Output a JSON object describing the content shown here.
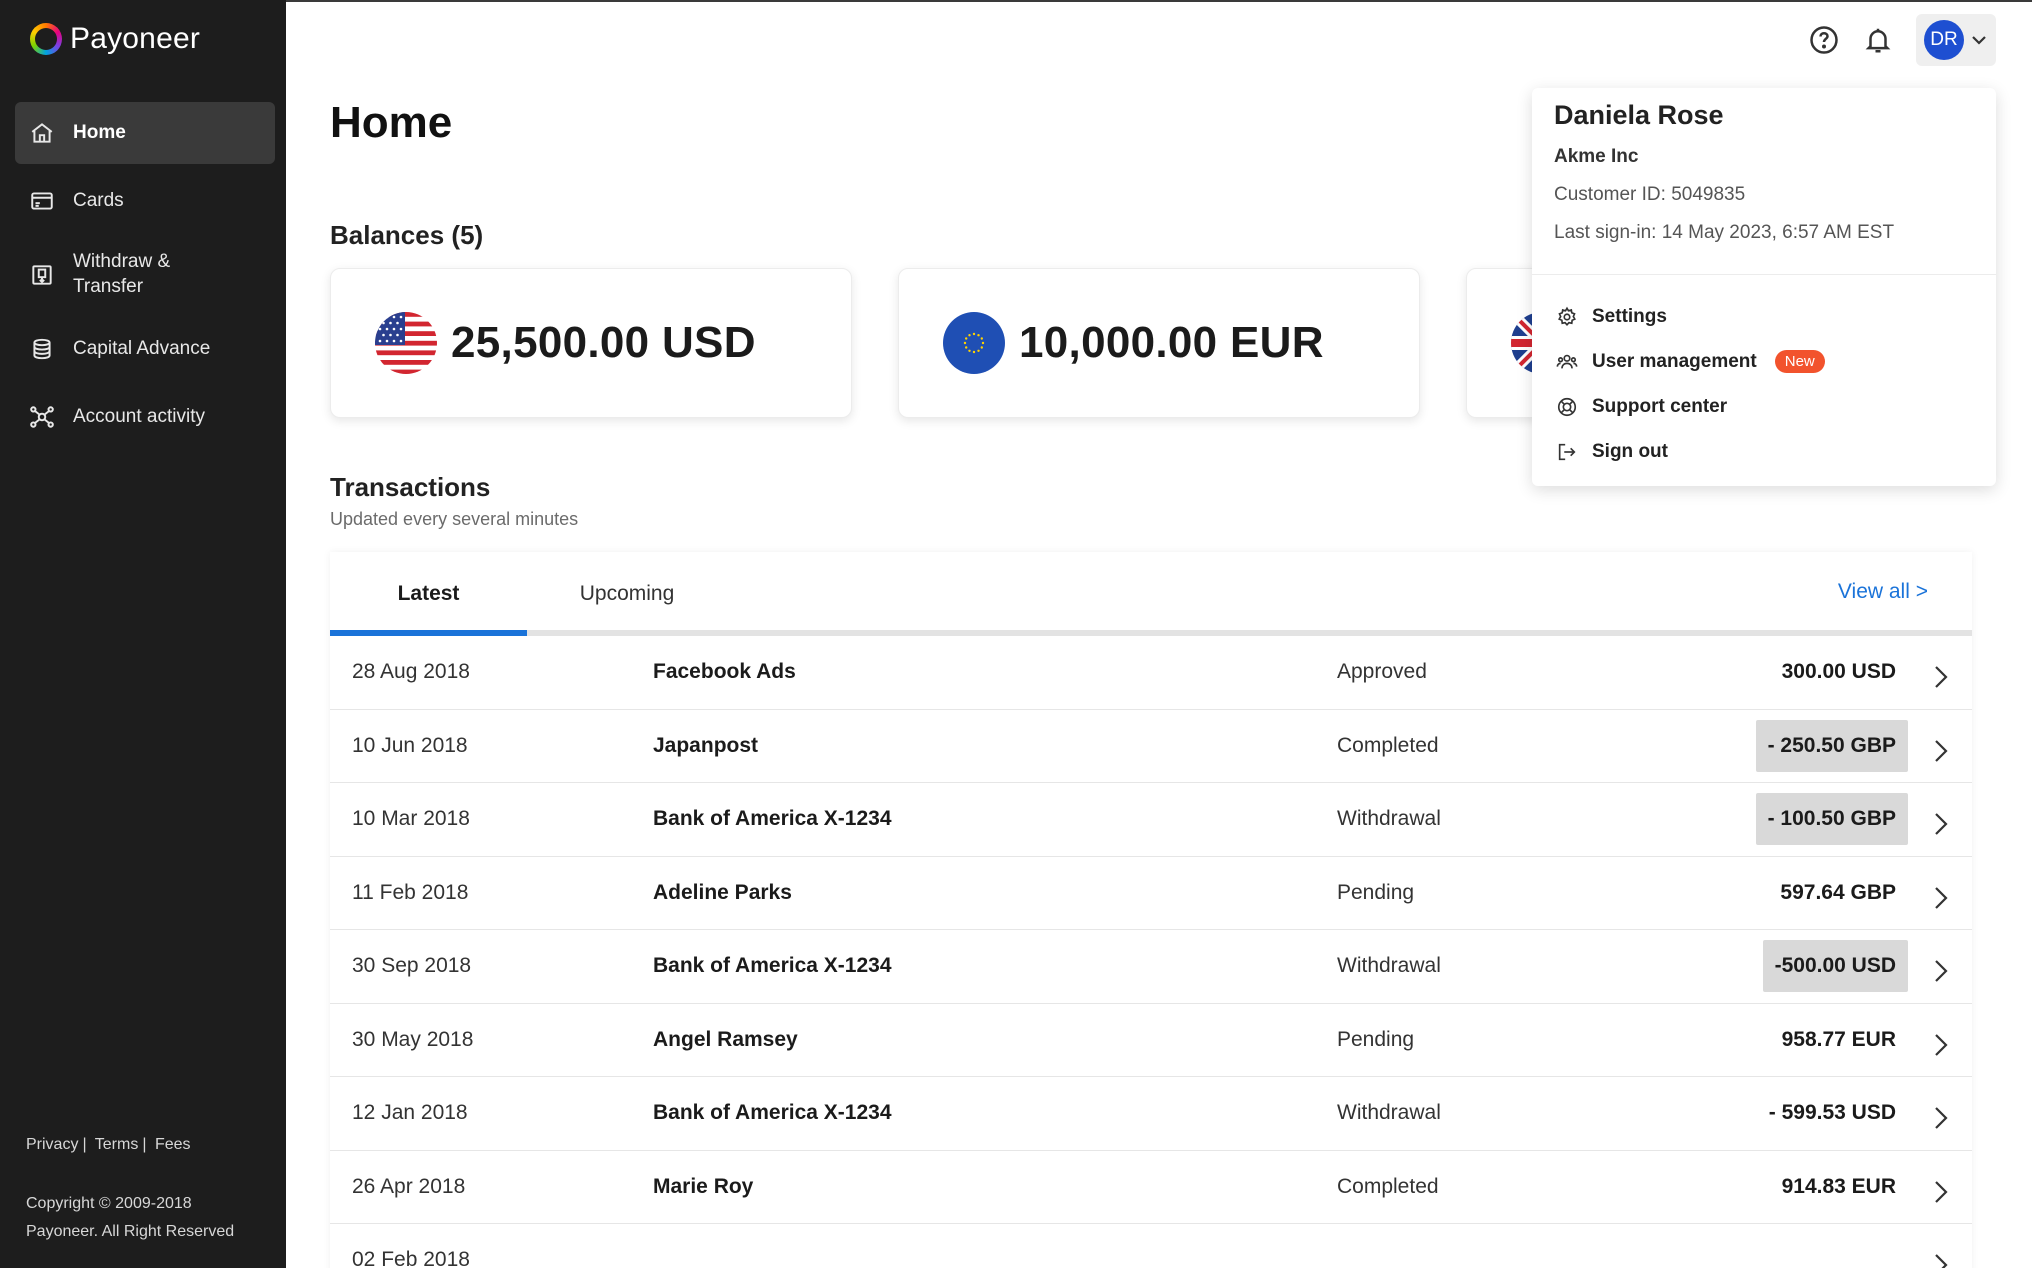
{
  "brand": {
    "name": "Payoneer"
  },
  "sidebar": {
    "items": [
      {
        "label": "Home",
        "icon": "home-icon",
        "active": true
      },
      {
        "label": "Cards",
        "icon": "card-icon"
      },
      {
        "label": "Withdraw & Transfer",
        "icon": "withdraw-icon"
      },
      {
        "label": "Capital Advance",
        "icon": "coins-icon"
      },
      {
        "label": "Account activity",
        "icon": "activity-icon"
      }
    ],
    "footer_links": [
      "Privacy",
      "Terms",
      "Fees"
    ],
    "footer_separator": "|",
    "copyright_line1": "Copyright © 2009-2018",
    "copyright_line2": "Payoneer. All Right Reserved"
  },
  "header": {
    "title": "Home",
    "avatar_initials": "DR"
  },
  "balances": {
    "title": "Balances (5)",
    "cards": [
      {
        "amount": "25,500.00 USD",
        "flag": "us-flag-icon"
      },
      {
        "amount": "10,000.00 EUR",
        "flag": "eu-flag-icon"
      },
      {
        "amount": "",
        "flag": "uk-flag-icon"
      }
    ]
  },
  "transactions": {
    "title": "Transactions",
    "subtitle": "Updated every several minutes",
    "tabs": [
      "Latest",
      "Upcoming"
    ],
    "active_tab": "Latest",
    "view_all": "View all >",
    "rows": [
      {
        "date": "28 Aug 2018",
        "name": "Facebook Ads",
        "status": "Approved",
        "amount": "300.00 USD",
        "highlight": false
      },
      {
        "date": "10 Jun 2018",
        "name": "Japanpost",
        "status": "Completed",
        "amount": "- 250.50 GBP",
        "highlight": true
      },
      {
        "date": "10 Mar 2018",
        "name": "Bank of America X-1234",
        "status": "Withdrawal",
        "amount": "- 100.50 GBP",
        "highlight": true
      },
      {
        "date": "11 Feb 2018",
        "name": "Adeline Parks",
        "status": "Pending",
        "amount": "597.64 GBP",
        "highlight": false
      },
      {
        "date": "30 Sep 2018",
        "name": "Bank of America X-1234",
        "status": "Withdrawal",
        "amount": "-500.00 USD",
        "highlight": true
      },
      {
        "date": "30 May 2018",
        "name": "Angel Ramsey",
        "status": "Pending",
        "amount": "958.77 EUR",
        "highlight": false
      },
      {
        "date": "12 Jan 2018",
        "name": "Bank of America X-1234",
        "status": "Withdrawal",
        "amount": "- 599.53 USD",
        "highlight": false
      },
      {
        "date": "26 Apr 2018",
        "name": "Marie Roy",
        "status": "Completed",
        "amount": "914.83 EUR",
        "highlight": false
      },
      {
        "date": "02 Feb 2018",
        "name": "",
        "status": "",
        "amount": "",
        "highlight": false
      }
    ]
  },
  "profile_menu": {
    "name": "Daniela Rose",
    "company": "Akme Inc",
    "customer_id": "Customer ID: 5049835",
    "last_signin": "Last sign-in:  14 May 2023, 6:57 AM EST",
    "items": [
      {
        "label": "Settings",
        "icon": "gear-icon"
      },
      {
        "label": "User management",
        "icon": "users-icon",
        "badge": "New"
      },
      {
        "label": "Support center",
        "icon": "lifebuoy-icon"
      },
      {
        "label": "Sign out",
        "icon": "sign-out-icon"
      }
    ]
  },
  "colors": {
    "sidebar_bg": "#1d1d1d",
    "accent": "#1a73d9",
    "badge": "#f2532d",
    "avatar": "#1e4fd1"
  }
}
